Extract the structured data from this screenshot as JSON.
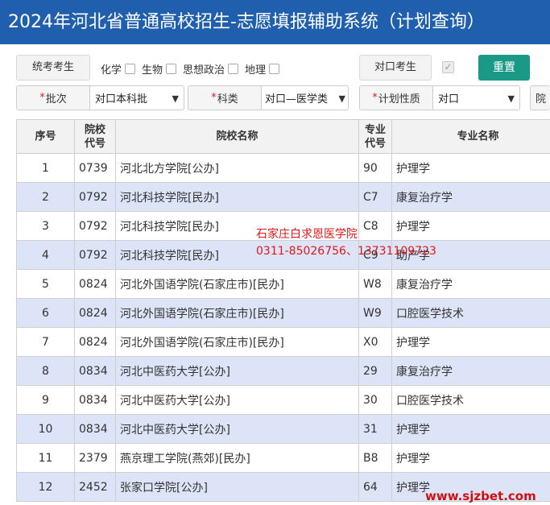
{
  "header": {
    "title": "2024年河北省普通高校招生-志愿填报辅助系统（计划查询）"
  },
  "filters": {
    "tongkao_label": "统考考生",
    "subjects": [
      {
        "label": "化学",
        "checked": false
      },
      {
        "label": "生物",
        "checked": false
      },
      {
        "label": "思想政治",
        "checked": false
      },
      {
        "label": "地理",
        "checked": false
      }
    ],
    "duikou_label": "对口考生",
    "duikou_checked": true,
    "duikou_check_glyph": "✓",
    "reset_label": "重置"
  },
  "selectors": {
    "batch": {
      "required": "*",
      "label": "批次",
      "value": "对口本科批"
    },
    "category": {
      "required": "*",
      "label": "科类",
      "value": "对口—医学类"
    },
    "plan_nature": {
      "required": "*",
      "label": "计划性质",
      "value": "对口"
    },
    "school_partial": "院"
  },
  "table": {
    "headers": {
      "index": "序号",
      "school_code": [
        "院校",
        "代号"
      ],
      "school_name": "院校名称",
      "major_code": [
        "专业",
        "代号"
      ],
      "major_name": "专业名称"
    },
    "rows": [
      {
        "no": "1",
        "school_code": "0739",
        "school_name": "河北北方学院[公办]",
        "major_code": "90",
        "major_name": "护理学"
      },
      {
        "no": "2",
        "school_code": "0792",
        "school_name": "河北科技学院[民办]",
        "major_code": "C7",
        "major_name": "康复治疗学"
      },
      {
        "no": "3",
        "school_code": "0792",
        "school_name": "河北科技学院[民办]",
        "major_code": "C8",
        "major_name": "护理学"
      },
      {
        "no": "4",
        "school_code": "0792",
        "school_name": "河北科技学院[民办]",
        "major_code": "C9",
        "major_name": "助产学"
      },
      {
        "no": "5",
        "school_code": "0824",
        "school_name": "河北外国语学院(石家庄市)[民办]",
        "major_code": "W8",
        "major_name": "康复治疗学"
      },
      {
        "no": "6",
        "school_code": "0824",
        "school_name": "河北外国语学院(石家庄市)[民办]",
        "major_code": "W9",
        "major_name": "口腔医学技术"
      },
      {
        "no": "7",
        "school_code": "0824",
        "school_name": "河北外国语学院(石家庄市)[民办]",
        "major_code": "X0",
        "major_name": "护理学"
      },
      {
        "no": "8",
        "school_code": "0834",
        "school_name": "河北中医药大学[公办]",
        "major_code": "29",
        "major_name": "康复治疗学"
      },
      {
        "no": "9",
        "school_code": "0834",
        "school_name": "河北中医药大学[公办]",
        "major_code": "30",
        "major_name": "口腔医学技术"
      },
      {
        "no": "10",
        "school_code": "0834",
        "school_name": "河北中医药大学[公办]",
        "major_code": "31",
        "major_name": "护理学"
      },
      {
        "no": "11",
        "school_code": "2379",
        "school_name": "燕京理工学院(燕郊)[民办]",
        "major_code": "B8",
        "major_name": "护理学"
      },
      {
        "no": "12",
        "school_code": "2452",
        "school_name": "张家口学院[公办]",
        "major_code": "64",
        "major_name": "护理学"
      }
    ]
  },
  "overlay": {
    "line1": "石家庄白求恩医学院",
    "line2": "0311-85026756、13731109723"
  },
  "watermark": "www.sjzbet.com",
  "colors": {
    "title_bar": "#1f5fae",
    "reset_button": "#1a9a86",
    "alt_row": "#dde4f8",
    "overlay_text": "#e01818"
  }
}
